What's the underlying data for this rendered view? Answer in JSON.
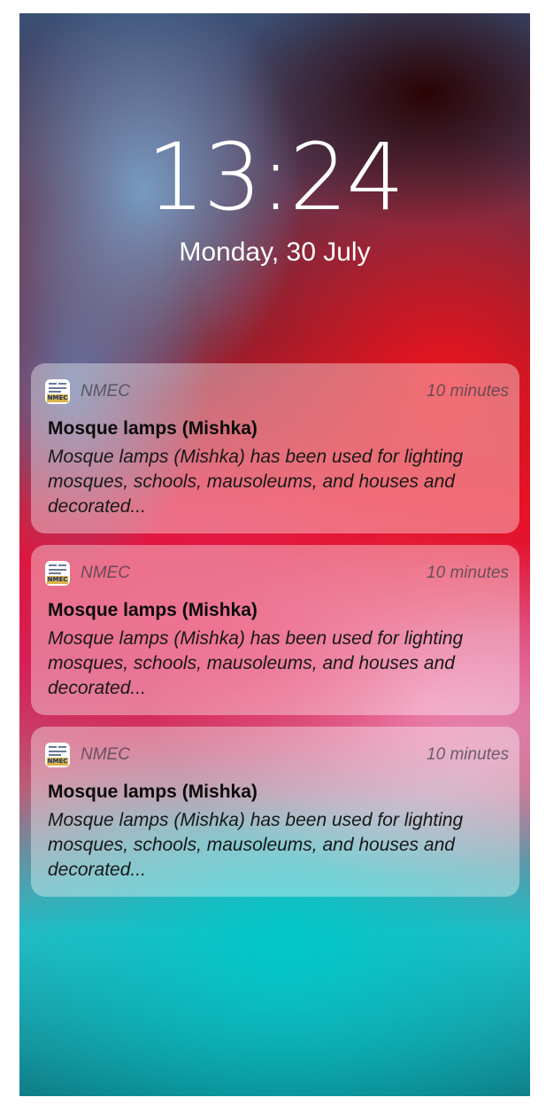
{
  "lockscreen": {
    "time": "13:24",
    "date": "Monday, 30 July"
  },
  "notifications": [
    {
      "app_name": "NMEC",
      "icon_badge": "NMEC",
      "time": "10 minutes",
      "title": "Mosque lamps (Mishka)",
      "body": "Mosque lamps (Mishka) has been used for lighting mosques, schools, mausoleums, and houses and decorated..."
    },
    {
      "app_name": "NMEC",
      "icon_badge": "NMEC",
      "time": "10 minutes",
      "title": "Mosque lamps (Mishka)",
      "body": "Mosque lamps (Mishka) has been used for lighting mosques, schools, mausoleums, and houses and decorated..."
    },
    {
      "app_name": "NMEC",
      "icon_badge": "NMEC",
      "time": "10 minutes",
      "title": "Mosque lamps (Mishka)",
      "body": "Mosque lamps (Mishka) has been used for lighting mosques, schools, mausoleums, and houses and decorated..."
    }
  ],
  "colors": {
    "text_primary": "#ffffff",
    "notification_bg": "rgba(255,255,255,0.38)",
    "icon_badge_gold": "#d9b44a",
    "icon_badge_navy": "#1c2f6a"
  },
  "icons": {
    "app_icon": "nmec-app-icon"
  }
}
